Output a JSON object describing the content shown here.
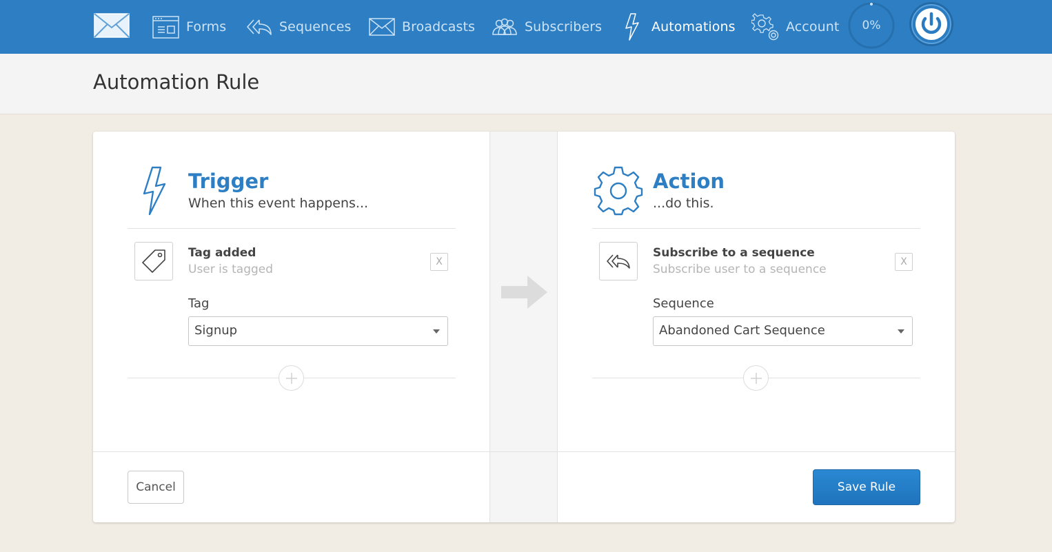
{
  "nav": {
    "items": [
      {
        "label": "Forms",
        "icon": "form-icon"
      },
      {
        "label": "Sequences",
        "icon": "sequence-icon"
      },
      {
        "label": "Broadcasts",
        "icon": "envelope-icon"
      },
      {
        "label": "Subscribers",
        "icon": "users-icon"
      },
      {
        "label": "Automations",
        "icon": "lightning-icon",
        "active": true
      },
      {
        "label": "Account",
        "icon": "gear-icon"
      }
    ],
    "progress": "0%",
    "colors": {
      "bar": "#2d7ec3",
      "text": "#cde3f6",
      "active_text": "#ffffff"
    }
  },
  "page": {
    "title": "Automation Rule"
  },
  "trigger": {
    "title": "Trigger",
    "subtitle": "When this event happens...",
    "item_title": "Tag added",
    "item_desc": "User is tagged",
    "remove_label": "X",
    "field_label": "Tag",
    "field_value": "Signup"
  },
  "action": {
    "title": "Action",
    "subtitle": "...do this.",
    "item_title": "Subscribe to a sequence",
    "item_desc": "Subscribe user to a sequence",
    "remove_label": "X",
    "field_label": "Sequence",
    "field_value": "Abandoned Cart Sequence"
  },
  "footer": {
    "cancel_label": "Cancel",
    "save_label": "Save Rule"
  },
  "theme": {
    "accent": "#2d7ec3",
    "save_button": "#2a88d2",
    "page_bg": "#f1ece4"
  }
}
